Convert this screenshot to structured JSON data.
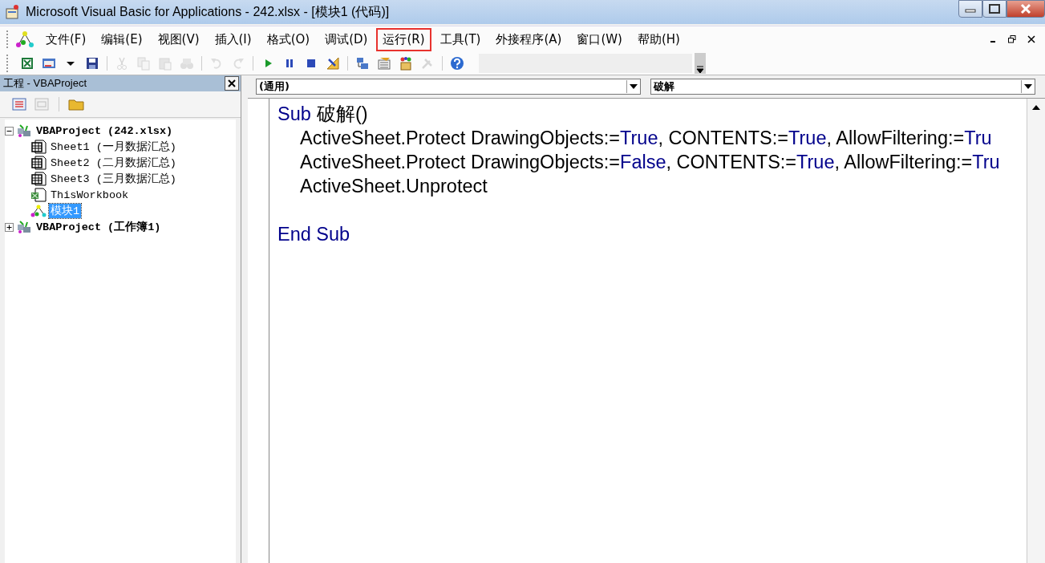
{
  "window": {
    "title": "Microsoft Visual Basic for Applications - 242.xlsx - [模块1 (代码)]"
  },
  "menu": [
    {
      "label": "文件(F)",
      "highlighted": false
    },
    {
      "label": "编辑(E)",
      "highlighted": false
    },
    {
      "label": "视图(V)",
      "highlighted": false
    },
    {
      "label": "插入(I)",
      "highlighted": false
    },
    {
      "label": "格式(O)",
      "highlighted": false
    },
    {
      "label": "调试(D)",
      "highlighted": false
    },
    {
      "label": "运行(R)",
      "highlighted": true
    },
    {
      "label": "工具(T)",
      "highlighted": false
    },
    {
      "label": "外接程序(A)",
      "highlighted": false
    },
    {
      "label": "窗口(W)",
      "highlighted": false
    },
    {
      "label": "帮助(H)",
      "highlighted": false
    }
  ],
  "toolbar": [
    {
      "disabled": false
    },
    {
      "disabled": false
    },
    {
      "disabled": false
    },
    {
      "disabled": false
    },
    {
      "disabled": true
    },
    {
      "disabled": true
    },
    {
      "disabled": true
    },
    {
      "disabled": true
    },
    {
      "disabled": true
    },
    {
      "disabled": true
    },
    {
      "disabled": false
    },
    {
      "disabled": false
    },
    {
      "disabled": false
    },
    {
      "disabled": false
    },
    {
      "disabled": false
    },
    {
      "disabled": false
    },
    {
      "disabled": false
    },
    {
      "disabled": true
    },
    {
      "disabled": false
    }
  ],
  "project_panel": {
    "title": "工程 - VBAProject",
    "tree": [
      {
        "label": "VBAProject (242.xlsx)",
        "kind": "project",
        "expanded": true,
        "selected": false,
        "children": [
          {
            "label": "Sheet1 (一月数据汇总)",
            "kind": "sheet",
            "selected": false
          },
          {
            "label": "Sheet2 (二月数据汇总)",
            "kind": "sheet",
            "selected": false
          },
          {
            "label": "Sheet3 (三月数据汇总)",
            "kind": "sheet",
            "selected": false
          },
          {
            "label": "ThisWorkbook",
            "kind": "workbook",
            "selected": false
          },
          {
            "label": "模块1",
            "kind": "module",
            "selected": true
          }
        ]
      },
      {
        "label": "VBAProject (工作簿1)",
        "kind": "project",
        "expanded": false,
        "selected": false
      }
    ]
  },
  "code_window": {
    "object_dropdown": "(通用)",
    "procedure_dropdown": "破解",
    "lines": [
      {
        "kind": "top",
        "tokens": [
          {
            "text": "Sub",
            "kind": "keyword"
          },
          {
            "text": "破解()",
            "kind": "plain"
          }
        ]
      },
      {
        "kind": "indented",
        "tokens": [
          {
            "text": "ActiveSheet.Protect DrawingObjects:=",
            "kind": "plain"
          },
          {
            "text": "True",
            "kind": "keyword"
          },
          {
            "text": ", CONTENTS:=",
            "kind": "plain"
          },
          {
            "text": "True",
            "kind": "keyword"
          },
          {
            "text": ", AllowFiltering:=",
            "kind": "plain"
          },
          {
            "text": "Tru",
            "kind": "keyword"
          }
        ]
      },
      {
        "kind": "indented",
        "tokens": [
          {
            "text": "ActiveSheet.Protect DrawingObjects:=",
            "kind": "plain"
          },
          {
            "text": "False",
            "kind": "keyword"
          },
          {
            "text": ", CONTENTS:=",
            "kind": "plain"
          },
          {
            "text": "True",
            "kind": "keyword"
          },
          {
            "text": ", AllowFiltering:=",
            "kind": "plain"
          },
          {
            "text": "Tru",
            "kind": "keyword"
          }
        ]
      },
      {
        "kind": "indented",
        "tokens": [
          {
            "text": "ActiveSheet.Unprotect",
            "kind": "plain"
          }
        ]
      },
      {
        "kind": "blank"
      },
      {
        "kind": "top",
        "tokens": [
          {
            "text": "End Sub",
            "kind": "keyword"
          }
        ]
      }
    ]
  }
}
